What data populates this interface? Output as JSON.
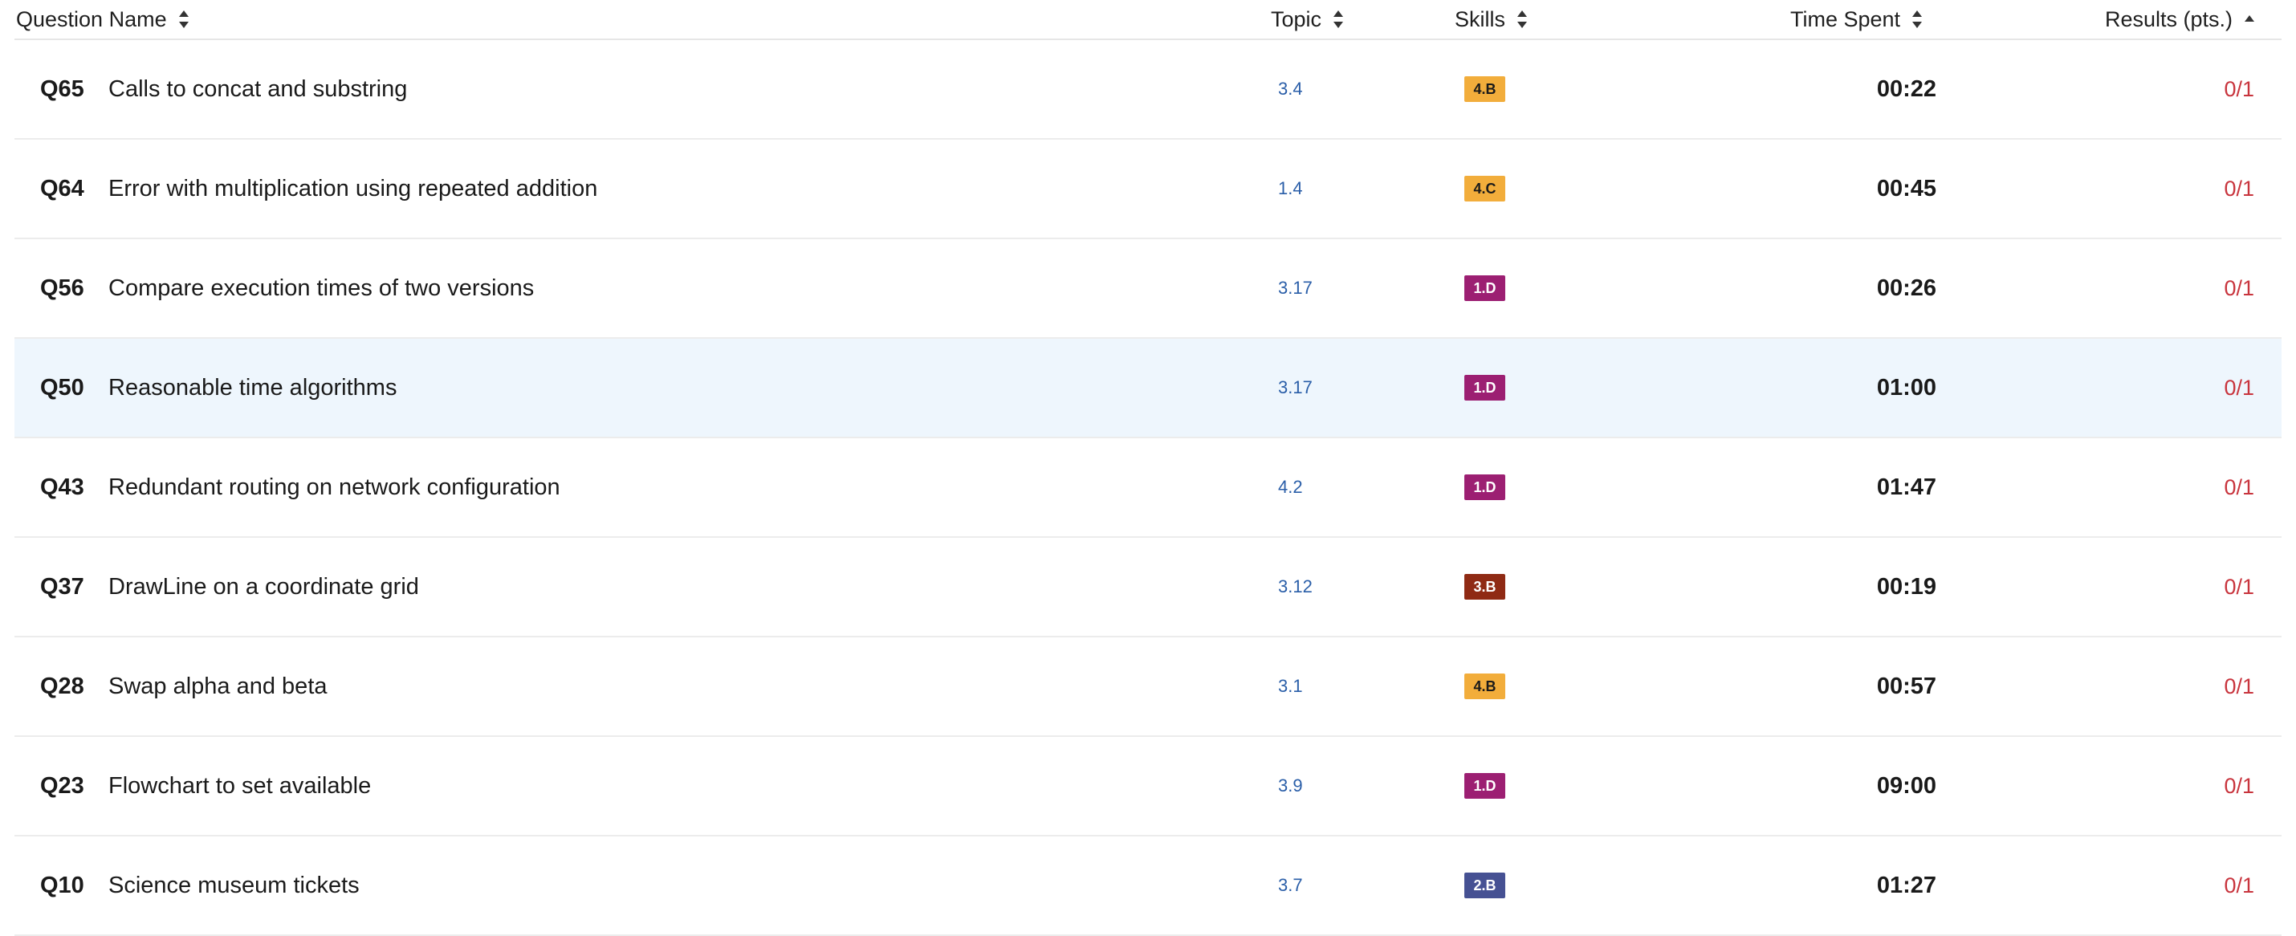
{
  "header": {
    "question_name": "Question Name",
    "topic": "Topic",
    "skills": "Skills",
    "time_spent": "Time Spent",
    "results": "Results (pts.)"
  },
  "colors": {
    "skill_4B": "#f2ad3b",
    "skill_4C": "#f2ad3b",
    "skill_1D": "#9c1f72",
    "skill_3B": "#8f2a14",
    "skill_2B": "#465193",
    "topic_link": "#2a5ea8",
    "result_red": "#c8343d",
    "highlight_row": "#eef6fd"
  },
  "rows": [
    {
      "q": "Q65",
      "name": "Calls to concat and substring",
      "topic": "3.4",
      "skill": "4.B",
      "skill_color": "#f2ad3b",
      "skill_text": "#1a1a1a",
      "time": "00:22",
      "result": "0/1"
    },
    {
      "q": "Q64",
      "name": "Error with multiplication using repeated addition",
      "topic": "1.4",
      "skill": "4.C",
      "skill_color": "#f2ad3b",
      "skill_text": "#1a1a1a",
      "time": "00:45",
      "result": "0/1"
    },
    {
      "q": "Q56",
      "name": "Compare execution times of two versions",
      "topic": "3.17",
      "skill": "1.D",
      "skill_color": "#9c1f72",
      "skill_text": "#ffffff",
      "time": "00:26",
      "result": "0/1"
    },
    {
      "q": "Q50",
      "name": "Reasonable time algorithms",
      "topic": "3.17",
      "skill": "1.D",
      "skill_color": "#9c1f72",
      "skill_text": "#ffffff",
      "time": "01:00",
      "result": "0/1"
    },
    {
      "q": "Q43",
      "name": "Redundant routing on network configuration",
      "topic": "4.2",
      "skill": "1.D",
      "skill_color": "#9c1f72",
      "skill_text": "#ffffff",
      "time": "01:47",
      "result": "0/1"
    },
    {
      "q": "Q37",
      "name": "DrawLine on a coordinate grid",
      "topic": "3.12",
      "skill": "3.B",
      "skill_color": "#8f2a14",
      "skill_text": "#ffffff",
      "time": "00:19",
      "result": "0/1"
    },
    {
      "q": "Q28",
      "name": "Swap alpha and beta",
      "topic": "3.1",
      "skill": "4.B",
      "skill_color": "#f2ad3b",
      "skill_text": "#1a1a1a",
      "time": "00:57",
      "result": "0/1"
    },
    {
      "q": "Q23",
      "name": "Flowchart to set available",
      "topic": "3.9",
      "skill": "1.D",
      "skill_color": "#9c1f72",
      "skill_text": "#ffffff",
      "time": "09:00",
      "result": "0/1"
    },
    {
      "q": "Q10",
      "name": "Science museum tickets",
      "topic": "3.7",
      "skill": "2.B",
      "skill_color": "#465193",
      "skill_text": "#ffffff",
      "time": "01:27",
      "result": "0/1"
    }
  ]
}
